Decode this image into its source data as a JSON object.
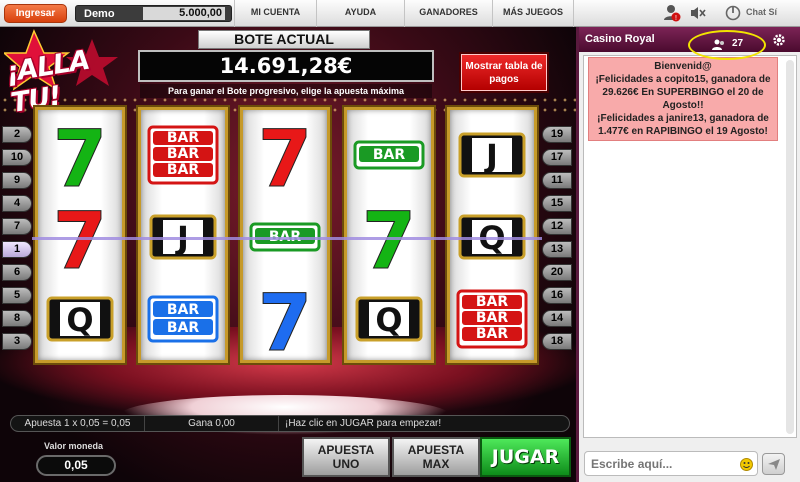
{
  "topbar": {
    "login_label": "Ingresar",
    "demo_label": "Demo",
    "demo_balance": "5.000,00",
    "nav": [
      "MI CUENTA",
      "AYUDA",
      "GANADORES",
      "MÁS JUEGOS"
    ],
    "chat_toggle": "Chat Sí"
  },
  "game": {
    "logo_text": "¡ALLA TU!",
    "bote_title": "BOTE ACTUAL",
    "bote_amount": "14.691,28€",
    "bote_note": "Para ganar el Bote progresivo, elige la apuesta máxima",
    "paytable_button": "Mostrar tabla de pagos",
    "left_lines": [
      "2",
      "10",
      "9",
      "4",
      "7",
      "1",
      "6",
      "5",
      "8",
      "3"
    ],
    "right_lines": [
      "19",
      "17",
      "11",
      "15",
      "12",
      "13",
      "20",
      "16",
      "14",
      "18"
    ],
    "active_line": "1",
    "reels": [
      [
        "seven-green",
        "seven-red",
        "q"
      ],
      [
        "bar-triple-red",
        "j",
        "bar-double-blue"
      ],
      [
        "seven-red",
        "bar-single-green",
        "seven-blue"
      ],
      [
        "bar-single-green",
        "seven-green",
        "q"
      ],
      [
        "j",
        "q",
        "bar-triple-red"
      ]
    ],
    "symbol_text": {
      "bar": "BAR",
      "j": "J",
      "q": "Q",
      "seven": "7"
    },
    "colors": {
      "red_seven": "#e81818",
      "green_seven": "#14b414",
      "blue_seven": "#1e6cf0",
      "payline": "#a08ce0"
    }
  },
  "controls": {
    "bet_info": "Apuesta 1 x 0,05 = 0,05",
    "win_info": "Gana 0,00",
    "message": "¡Haz clic en JUGAR para empezar!",
    "coin_label": "Valor moneda",
    "coin_value": "0,05",
    "bet_one_label": "APUESTA UNO",
    "bet_max_label": "APUESTA MAX",
    "play_label": "JUGAR"
  },
  "chat": {
    "room": "Casino Royal",
    "user_count": "27",
    "welcome_lines": [
      "Bienvenid@",
      "¡Felicidades a copito15, ganadora de 29.626€ En SUPERBINGO el 20 de Agosto!!",
      "¡Felicidades a janire13, ganadora de 1.477€ en RAPIBINGO el 19 Agosto!"
    ],
    "input_placeholder": "Escribe aquí..."
  }
}
